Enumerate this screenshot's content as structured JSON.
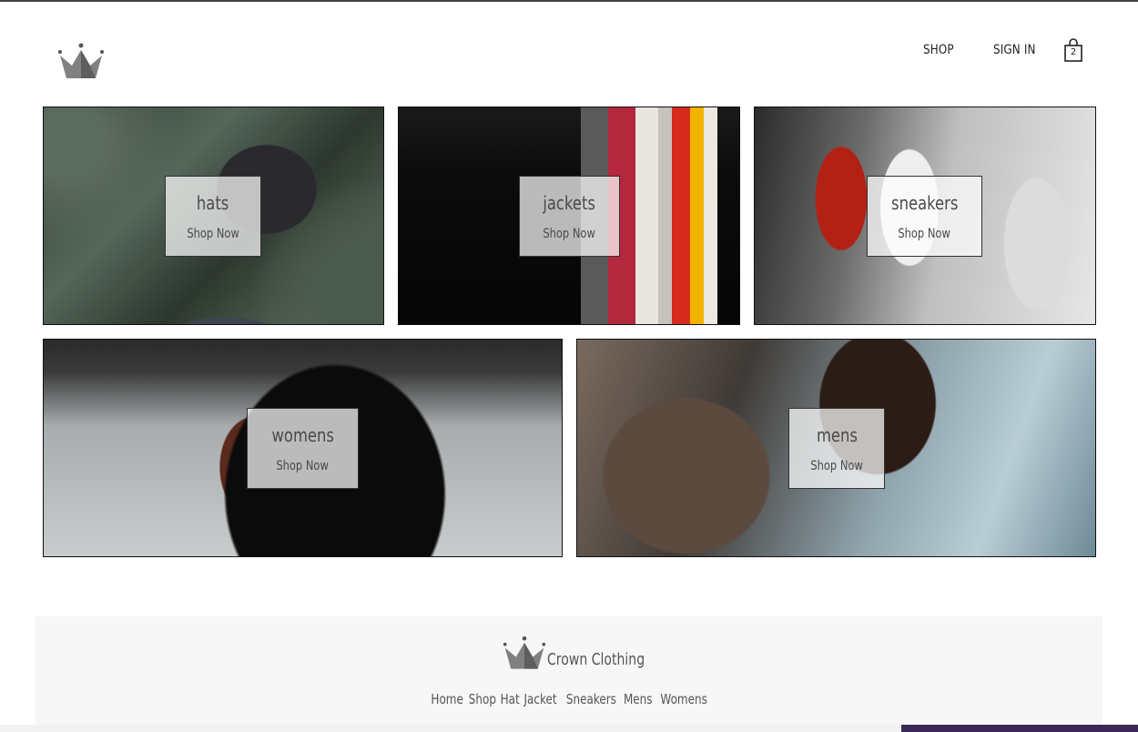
{
  "header": {
    "logo_icon": "crown-icon",
    "nav": [
      "SHOP",
      "SIGN IN"
    ],
    "cart": {
      "icon": "shopping-bag-icon",
      "count": "2"
    }
  },
  "categories": [
    {
      "title": "hats",
      "cta": "Shop Now"
    },
    {
      "title": "jackets",
      "cta": "Shop Now"
    },
    {
      "title": "sneakers",
      "cta": "Shop Now"
    },
    {
      "title": "womens",
      "cta": "Shop Now"
    },
    {
      "title": "mens",
      "cta": "Shop Now"
    }
  ],
  "footer": {
    "logo_icon": "crown-icon",
    "brand": "Crown Clothing",
    "links": [
      "Home",
      "Shop",
      "Hat",
      "Jacket",
      "Sneakers",
      "Mens",
      "Womens"
    ]
  },
  "colors": {
    "border": "#111111",
    "footer_bg": "#f7f7f7",
    "text": "#4a4a4a"
  }
}
